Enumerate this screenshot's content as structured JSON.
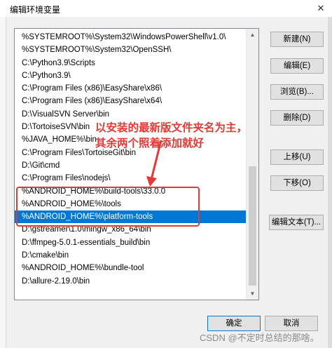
{
  "window": {
    "title": "编辑环境变量",
    "close_glyph": "✕"
  },
  "path_entries": [
    "%SYSTEMROOT%\\System32\\WindowsPowerShell\\v1.0\\",
    "%SYSTEMROOT%\\System32\\OpenSSH\\",
    "C:\\Python3.9\\Scripts",
    "C:\\Python3.9\\",
    "C:\\Program Files (x86)\\EasyShare\\x86\\",
    "C:\\Program Files (x86)\\EasyShare\\x64\\",
    "D:\\VisualSVN Server\\bin",
    "D:\\TortoiseSVN\\bin",
    "%JAVA_HOME%\\bin",
    "C:\\Program Files\\TortoiseGit\\bin",
    "D:\\Git\\cmd",
    "C:\\Program Files\\nodejs\\",
    "%ANDROID_HOME%\\build-tools\\33.0.0",
    "%ANDROID_HOME%\\tools",
    "%ANDROID_HOME%\\platform-tools",
    "D:\\gstreamer\\1.0\\mingw_x86_64\\bin",
    "D:\\ffmpeg-5.0.1-essentials_build\\bin",
    "D:\\cmake\\bin",
    "%ANDROID_HOME%\\bundle-tool",
    "D:\\allure-2.19.0\\bin"
  ],
  "selected_index": 14,
  "buttons": {
    "new": "新建(N)",
    "edit": "编辑(E)",
    "browse": "浏览(B)...",
    "delete": "删除(D)",
    "move_up": "上移(U)",
    "move_down": "下移(O)",
    "edit_text": "编辑文本(T)...",
    "ok": "确定",
    "cancel": "取消"
  },
  "annotation": {
    "line1": "以安装的最新版文件夹名为主，",
    "line2": "其余两个照着添加就好",
    "color": "#e53935"
  },
  "watermark": "CSDN @不定时总结的那啥。",
  "colors": {
    "selection": "#0078d7",
    "dialog_bg": "#f0f0f0"
  }
}
